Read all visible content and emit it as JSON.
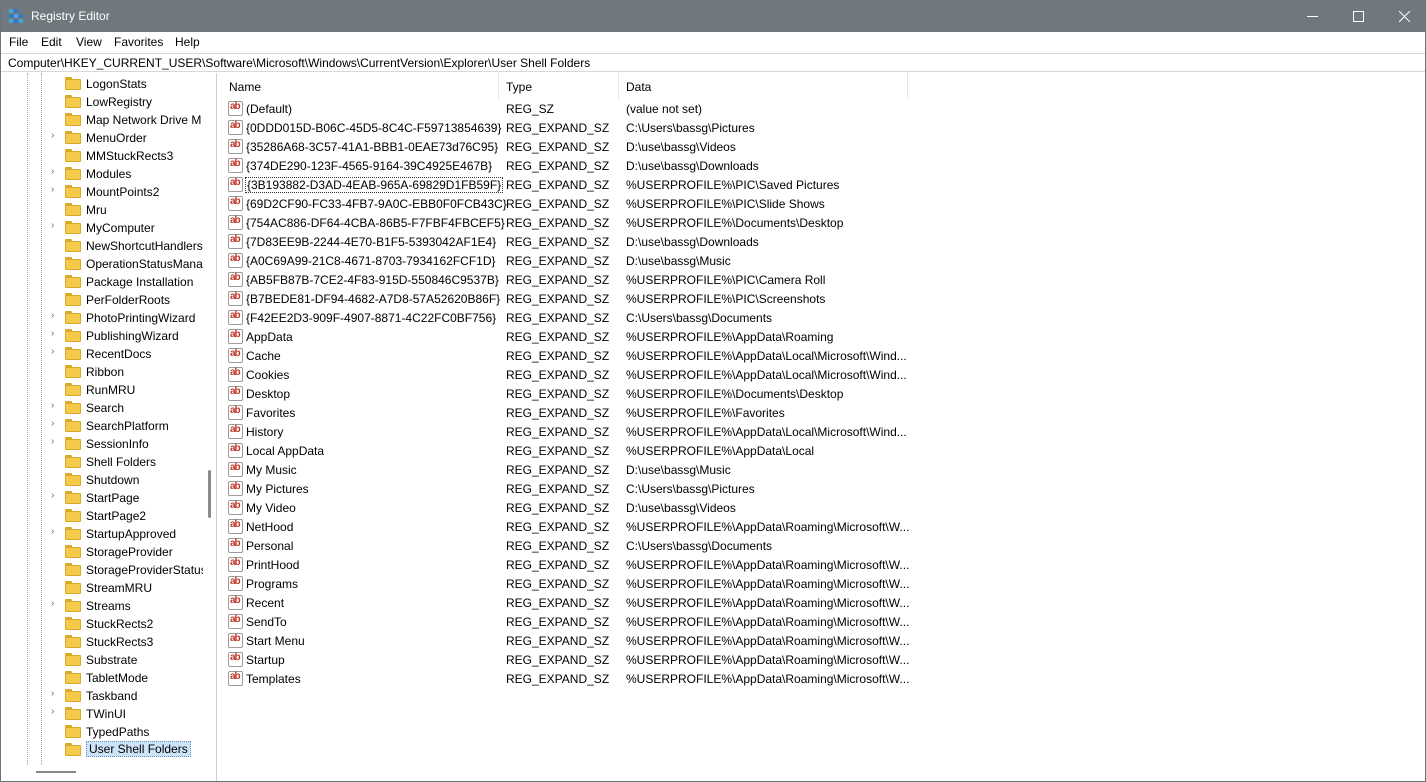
{
  "window": {
    "title": "Registry Editor"
  },
  "menu": [
    "File",
    "Edit",
    "View",
    "Favorites",
    "Help"
  ],
  "address": "Computer\\HKEY_CURRENT_USER\\Software\\Microsoft\\Windows\\CurrentVersion\\Explorer\\User Shell Folders",
  "tree": [
    {
      "label": "LogonStats",
      "expandable": false
    },
    {
      "label": "LowRegistry",
      "expandable": false
    },
    {
      "label": "Map Network Drive M",
      "expandable": false
    },
    {
      "label": "MenuOrder",
      "expandable": true
    },
    {
      "label": "MMStuckRects3",
      "expandable": false
    },
    {
      "label": "Modules",
      "expandable": true
    },
    {
      "label": "MountPoints2",
      "expandable": true
    },
    {
      "label": "Mru",
      "expandable": false
    },
    {
      "label": "MyComputer",
      "expandable": true
    },
    {
      "label": "NewShortcutHandlers",
      "expandable": false
    },
    {
      "label": "OperationStatusMana",
      "expandable": false
    },
    {
      "label": "Package Installation",
      "expandable": false
    },
    {
      "label": "PerFolderRoots",
      "expandable": false
    },
    {
      "label": "PhotoPrintingWizard",
      "expandable": true
    },
    {
      "label": "PublishingWizard",
      "expandable": true
    },
    {
      "label": "RecentDocs",
      "expandable": true
    },
    {
      "label": "Ribbon",
      "expandable": false
    },
    {
      "label": "RunMRU",
      "expandable": false
    },
    {
      "label": "Search",
      "expandable": true
    },
    {
      "label": "SearchPlatform",
      "expandable": true
    },
    {
      "label": "SessionInfo",
      "expandable": true
    },
    {
      "label": "Shell Folders",
      "expandable": false
    },
    {
      "label": "Shutdown",
      "expandable": false
    },
    {
      "label": "StartPage",
      "expandable": true
    },
    {
      "label": "StartPage2",
      "expandable": false
    },
    {
      "label": "StartupApproved",
      "expandable": true
    },
    {
      "label": "StorageProvider",
      "expandable": false
    },
    {
      "label": "StorageProviderStatus",
      "expandable": false
    },
    {
      "label": "StreamMRU",
      "expandable": false
    },
    {
      "label": "Streams",
      "expandable": true
    },
    {
      "label": "StuckRects2",
      "expandable": false
    },
    {
      "label": "StuckRects3",
      "expandable": false
    },
    {
      "label": "Substrate",
      "expandable": false
    },
    {
      "label": "TabletMode",
      "expandable": false
    },
    {
      "label": "Taskband",
      "expandable": true
    },
    {
      "label": "TWinUI",
      "expandable": true
    },
    {
      "label": "TypedPaths",
      "expandable": false
    },
    {
      "label": "User Shell Folders",
      "expandable": false,
      "selected": true
    }
  ],
  "columns": {
    "name": "Name",
    "type": "Type",
    "data": "Data"
  },
  "values": [
    {
      "name": "(Default)",
      "type": "REG_SZ",
      "data": "(value not set)"
    },
    {
      "name": "{0DDD015D-B06C-45D5-8C4C-F59713854639}",
      "type": "REG_EXPAND_SZ",
      "data": "C:\\Users\\bassg\\Pictures"
    },
    {
      "name": "{35286A68-3C57-41A1-BBB1-0EAE73d76C95}",
      "type": "REG_EXPAND_SZ",
      "data": "D:\\use\\bassg\\Videos"
    },
    {
      "name": "{374DE290-123F-4565-9164-39C4925E467B}",
      "type": "REG_EXPAND_SZ",
      "data": "D:\\use\\bassg\\Downloads"
    },
    {
      "name": "{3B193882-D3AD-4EAB-965A-69829D1FB59F}",
      "type": "REG_EXPAND_SZ",
      "data": "%USERPROFILE%\\PIC\\Saved Pictures",
      "focused": true
    },
    {
      "name": "{69D2CF90-FC33-4FB7-9A0C-EBB0F0FCB43C}",
      "type": "REG_EXPAND_SZ",
      "data": "%USERPROFILE%\\PIC\\Slide Shows"
    },
    {
      "name": "{754AC886-DF64-4CBA-86B5-F7FBF4FBCEF5}",
      "type": "REG_EXPAND_SZ",
      "data": "%USERPROFILE%\\Documents\\Desktop"
    },
    {
      "name": "{7D83EE9B-2244-4E70-B1F5-5393042AF1E4}",
      "type": "REG_EXPAND_SZ",
      "data": "D:\\use\\bassg\\Downloads"
    },
    {
      "name": "{A0C69A99-21C8-4671-8703-7934162FCF1D}",
      "type": "REG_EXPAND_SZ",
      "data": "D:\\use\\bassg\\Music"
    },
    {
      "name": "{AB5FB87B-7CE2-4F83-915D-550846C9537B}",
      "type": "REG_EXPAND_SZ",
      "data": "%USERPROFILE%\\PIC\\Camera Roll"
    },
    {
      "name": "{B7BEDE81-DF94-4682-A7D8-57A52620B86F}",
      "type": "REG_EXPAND_SZ",
      "data": "%USERPROFILE%\\PIC\\Screenshots"
    },
    {
      "name": "{F42EE2D3-909F-4907-8871-4C22FC0BF756}",
      "type": "REG_EXPAND_SZ",
      "data": "C:\\Users\\bassg\\Documents"
    },
    {
      "name": "AppData",
      "type": "REG_EXPAND_SZ",
      "data": "%USERPROFILE%\\AppData\\Roaming"
    },
    {
      "name": "Cache",
      "type": "REG_EXPAND_SZ",
      "data": "%USERPROFILE%\\AppData\\Local\\Microsoft\\Wind..."
    },
    {
      "name": "Cookies",
      "type": "REG_EXPAND_SZ",
      "data": "%USERPROFILE%\\AppData\\Local\\Microsoft\\Wind..."
    },
    {
      "name": "Desktop",
      "type": "REG_EXPAND_SZ",
      "data": "%USERPROFILE%\\Documents\\Desktop"
    },
    {
      "name": "Favorites",
      "type": "REG_EXPAND_SZ",
      "data": "%USERPROFILE%\\Favorites"
    },
    {
      "name": "History",
      "type": "REG_EXPAND_SZ",
      "data": "%USERPROFILE%\\AppData\\Local\\Microsoft\\Wind..."
    },
    {
      "name": "Local AppData",
      "type": "REG_EXPAND_SZ",
      "data": "%USERPROFILE%\\AppData\\Local"
    },
    {
      "name": "My Music",
      "type": "REG_EXPAND_SZ",
      "data": "D:\\use\\bassg\\Music"
    },
    {
      "name": "My Pictures",
      "type": "REG_EXPAND_SZ",
      "data": "C:\\Users\\bassg\\Pictures"
    },
    {
      "name": "My Video",
      "type": "REG_EXPAND_SZ",
      "data": "D:\\use\\bassg\\Videos"
    },
    {
      "name": "NetHood",
      "type": "REG_EXPAND_SZ",
      "data": "%USERPROFILE%\\AppData\\Roaming\\Microsoft\\W..."
    },
    {
      "name": "Personal",
      "type": "REG_EXPAND_SZ",
      "data": "C:\\Users\\bassg\\Documents"
    },
    {
      "name": "PrintHood",
      "type": "REG_EXPAND_SZ",
      "data": "%USERPROFILE%\\AppData\\Roaming\\Microsoft\\W..."
    },
    {
      "name": "Programs",
      "type": "REG_EXPAND_SZ",
      "data": "%USERPROFILE%\\AppData\\Roaming\\Microsoft\\W..."
    },
    {
      "name": "Recent",
      "type": "REG_EXPAND_SZ",
      "data": "%USERPROFILE%\\AppData\\Roaming\\Microsoft\\W..."
    },
    {
      "name": "SendTo",
      "type": "REG_EXPAND_SZ",
      "data": "%USERPROFILE%\\AppData\\Roaming\\Microsoft\\W..."
    },
    {
      "name": "Start Menu",
      "type": "REG_EXPAND_SZ",
      "data": "%USERPROFILE%\\AppData\\Roaming\\Microsoft\\W..."
    },
    {
      "name": "Startup",
      "type": "REG_EXPAND_SZ",
      "data": "%USERPROFILE%\\AppData\\Roaming\\Microsoft\\W..."
    },
    {
      "name": "Templates",
      "type": "REG_EXPAND_SZ",
      "data": "%USERPROFILE%\\AppData\\Roaming\\Microsoft\\W..."
    }
  ]
}
